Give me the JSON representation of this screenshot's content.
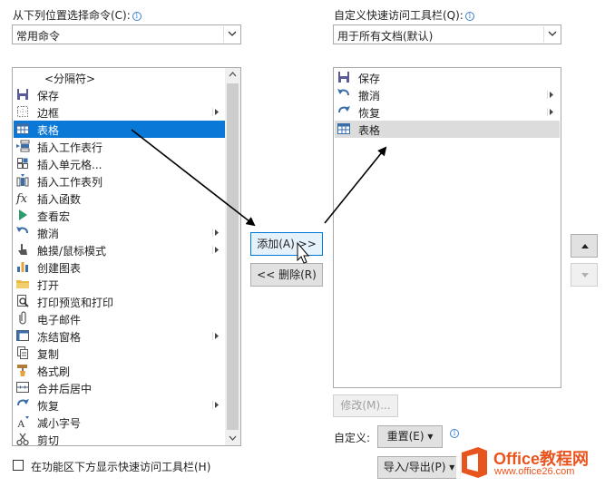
{
  "left": {
    "label": "从下列位置选择命令(C):",
    "combo_value": "常用命令",
    "items": [
      {
        "label": "<分隔符>",
        "icon": "separator-icon"
      },
      {
        "label": "保存",
        "icon": "save-icon"
      },
      {
        "label": "边框",
        "icon": "border-icon",
        "submenu": true
      },
      {
        "label": "表格",
        "icon": "table-icon",
        "selected": true
      },
      {
        "label": "插入工作表行",
        "icon": "insert-row-icon"
      },
      {
        "label": "插入单元格...",
        "icon": "insert-cell-icon"
      },
      {
        "label": "插入工作表列",
        "icon": "insert-column-icon"
      },
      {
        "label": "插入函数",
        "icon": "function-icon"
      },
      {
        "label": "查看宏",
        "icon": "play-macro-icon"
      },
      {
        "label": "撤消",
        "icon": "undo-icon",
        "submenu": true
      },
      {
        "label": "触摸/鼠标模式",
        "icon": "touch-icon",
        "submenu": true
      },
      {
        "label": "创建图表",
        "icon": "chart-icon"
      },
      {
        "label": "打开",
        "icon": "folder-icon"
      },
      {
        "label": "打印预览和打印",
        "icon": "print-preview-icon"
      },
      {
        "label": "电子邮件",
        "icon": "attachment-icon"
      },
      {
        "label": "冻结窗格",
        "icon": "freeze-panes-icon",
        "submenu": true
      },
      {
        "label": "复制",
        "icon": "copy-icon"
      },
      {
        "label": "格式刷",
        "icon": "format-painter-icon"
      },
      {
        "label": "合并后居中",
        "icon": "merge-center-icon"
      },
      {
        "label": "恢复",
        "icon": "redo-icon",
        "submenu": true
      },
      {
        "label": "减小字号",
        "icon": "decrease-font-icon"
      },
      {
        "label": "剪切",
        "icon": "cut-icon"
      }
    ],
    "show_below_label": "在功能区下方显示快速访问工具栏(H)"
  },
  "middle": {
    "add_label": "添加(A) >>",
    "remove_label": "<< 删除(R)"
  },
  "right": {
    "label": "自定义快速访问工具栏(Q):",
    "combo_value": "用于所有文档(默认)",
    "items": [
      {
        "label": "保存",
        "icon": "save-icon"
      },
      {
        "label": "撤消",
        "icon": "undo-icon",
        "submenu": true
      },
      {
        "label": "恢复",
        "icon": "redo-icon",
        "submenu": true
      },
      {
        "label": "表格",
        "icon": "table-icon",
        "selected": true
      }
    ],
    "modify_label": "修改(M)...",
    "customize_label": "自定义:",
    "reset_label": "重置(E) ▾",
    "import_export_label": "导入/导出(P) ▾"
  },
  "watermark": {
    "brand": "Office教程网",
    "url": "www.office26.com"
  },
  "colors": {
    "selection": "#0a78d7",
    "accent_orange": "#e8541e",
    "info_blue": "#3b7fd0"
  }
}
